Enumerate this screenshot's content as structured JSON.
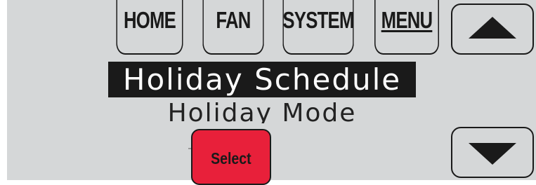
{
  "top_buttons": {
    "home": "HOME",
    "fan": "FAN",
    "system": "SYSTEM",
    "menu": "MENU"
  },
  "arrows": {
    "up_icon": "triangle-up-icon",
    "down_icon": "triangle-down-icon"
  },
  "display": {
    "selected_item": "Holiday Schedule",
    "next_item": "Holiday Mode"
  },
  "select_button": {
    "label": "Select",
    "color": "#e8203a"
  },
  "colors": {
    "screen_bg": "#d5d7d8",
    "highlight_bg": "#1a1a1a",
    "highlight_text": "#ffffff"
  }
}
